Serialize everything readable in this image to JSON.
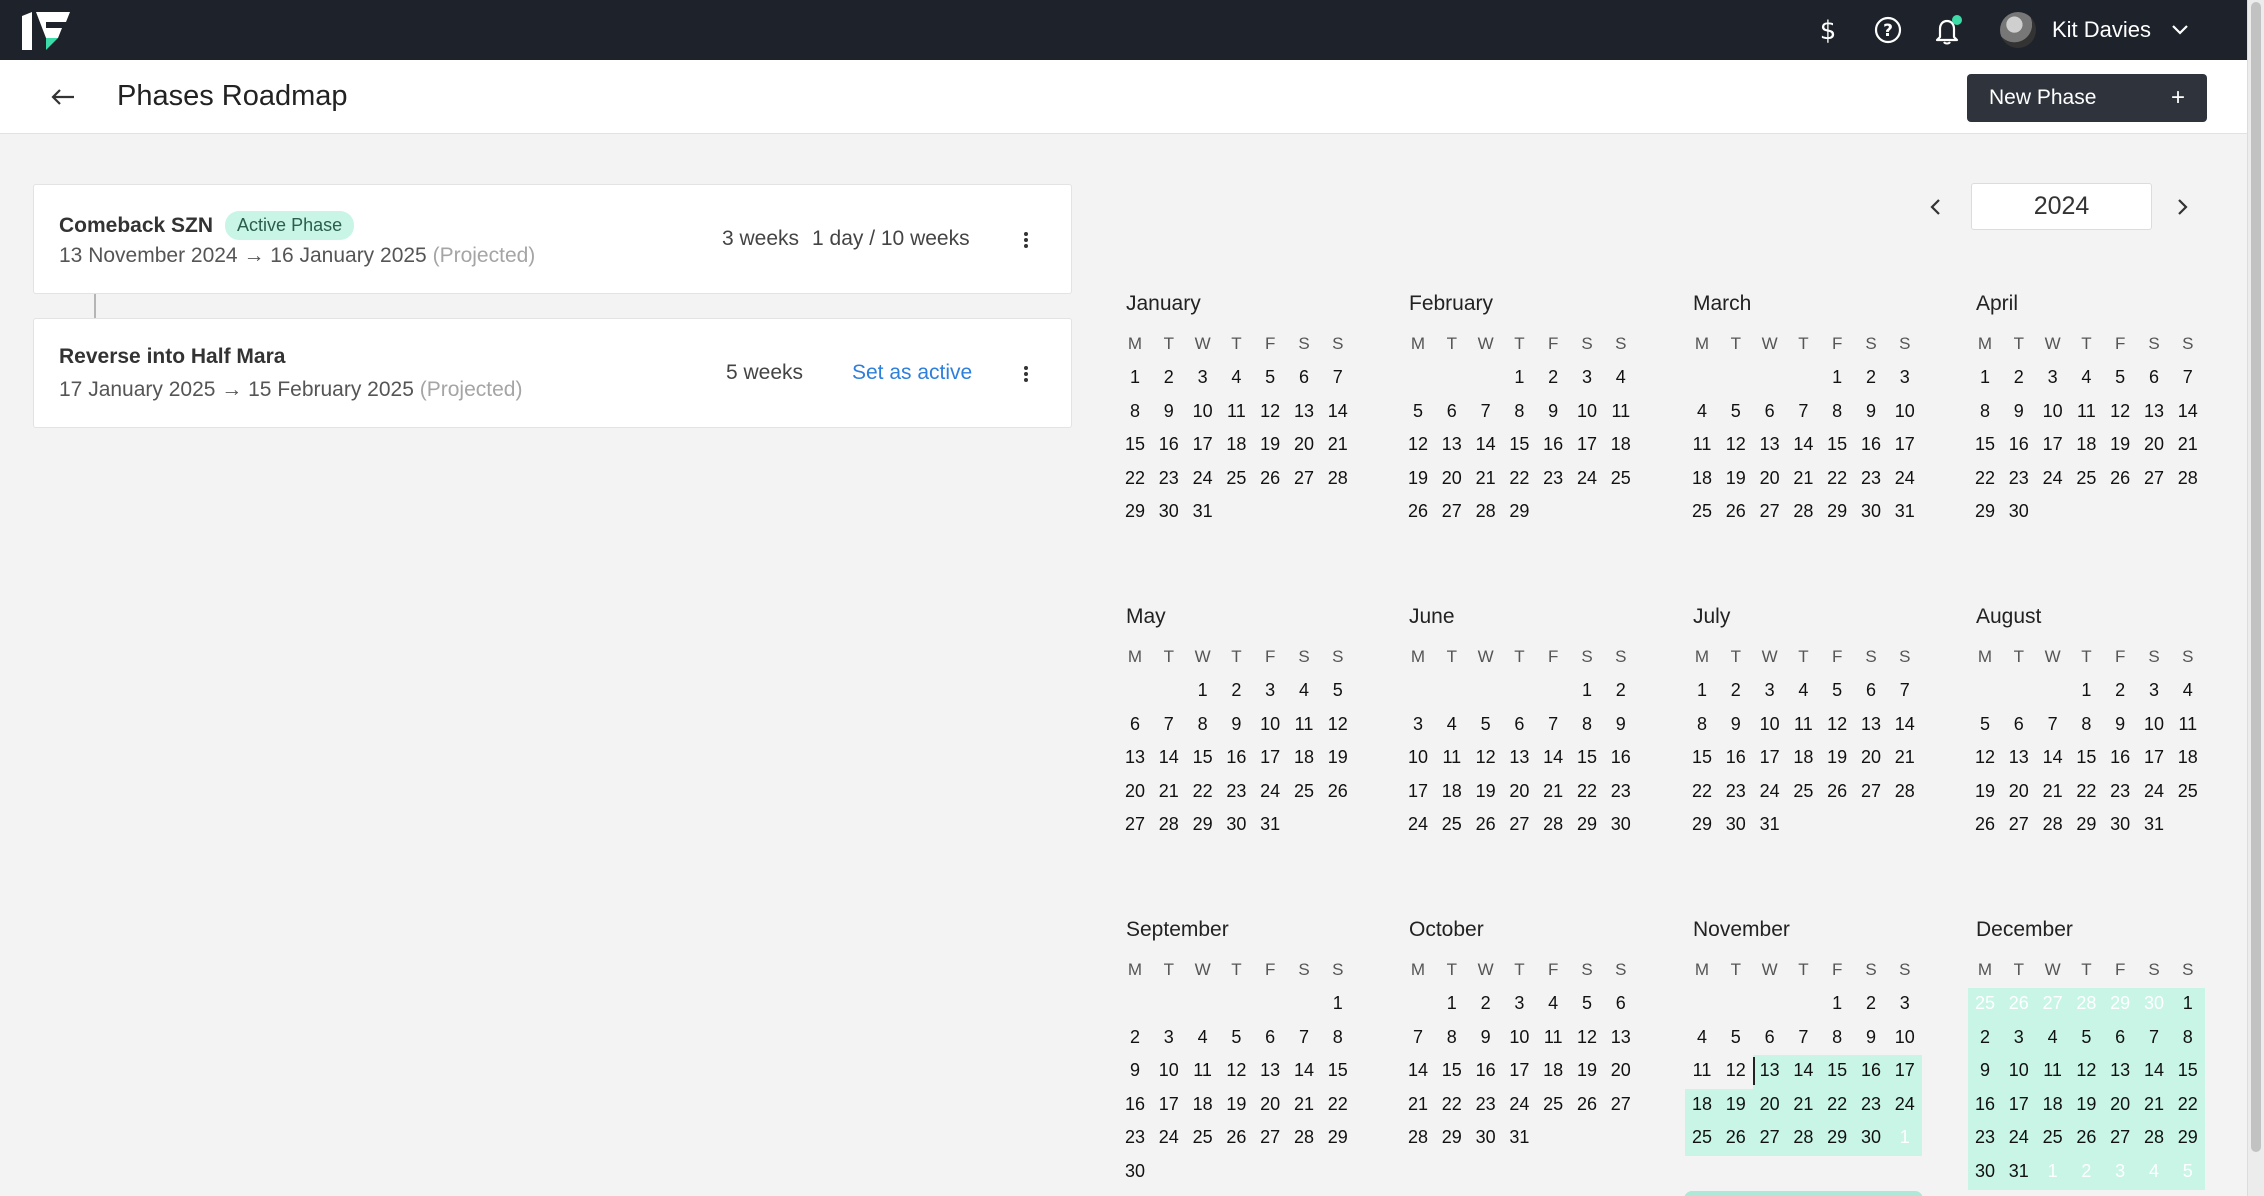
{
  "topbar": {
    "logo_icon": "brand-logo",
    "icons": [
      "dollar-icon",
      "help-icon",
      "bell-icon"
    ],
    "notification_dot_color": "#3ddba8",
    "user_name": "Kit Davies"
  },
  "header": {
    "title": "Phases Roadmap",
    "new_phase_label": "New Phase",
    "new_phase_plus": "+"
  },
  "phases": [
    {
      "name": "Comeback SZN",
      "badge": "Active Phase",
      "dates": "13 November 2024 → 16 January 2025",
      "projected": "(Projected)",
      "progress_weeks": "3 weeks",
      "progress_days": "1 day / 10 weeks"
    },
    {
      "name": "Reverse into Half Mara",
      "dates": "17 January 2025 → 15 February 2025",
      "projected": "(Projected)",
      "duration": "5 weeks",
      "action": "Set as active"
    }
  ],
  "calendar": {
    "year": "2024",
    "weekdays": [
      "M",
      "T",
      "W",
      "T",
      "F",
      "S",
      "S"
    ],
    "highlight_color": "#c8f5e6",
    "phase_label": "Comeback SZN",
    "months": [
      {
        "name": "January",
        "offset": 0,
        "days": 31
      },
      {
        "name": "February",
        "offset": 3,
        "days": 29
      },
      {
        "name": "March",
        "offset": 4,
        "days": 31
      },
      {
        "name": "April",
        "offset": 0,
        "days": 30
      },
      {
        "name": "May",
        "offset": 2,
        "days": 31
      },
      {
        "name": "June",
        "offset": 5,
        "days": 30
      },
      {
        "name": "July",
        "offset": 0,
        "days": 31
      },
      {
        "name": "August",
        "offset": 3,
        "days": 31
      },
      {
        "name": "September",
        "offset": 6,
        "days": 30
      },
      {
        "name": "October",
        "offset": 1,
        "days": 31
      },
      {
        "name": "November",
        "offset": 4,
        "days": 30,
        "highlight_from": 13,
        "trailing": [
          1
        ],
        "today": 13
      },
      {
        "name": "December",
        "offset": 6,
        "days": 31,
        "highlight_from": 1,
        "leading": [
          25,
          26,
          27,
          28,
          29,
          30
        ],
        "trailing": [
          1,
          2,
          3,
          4,
          5
        ]
      }
    ]
  }
}
